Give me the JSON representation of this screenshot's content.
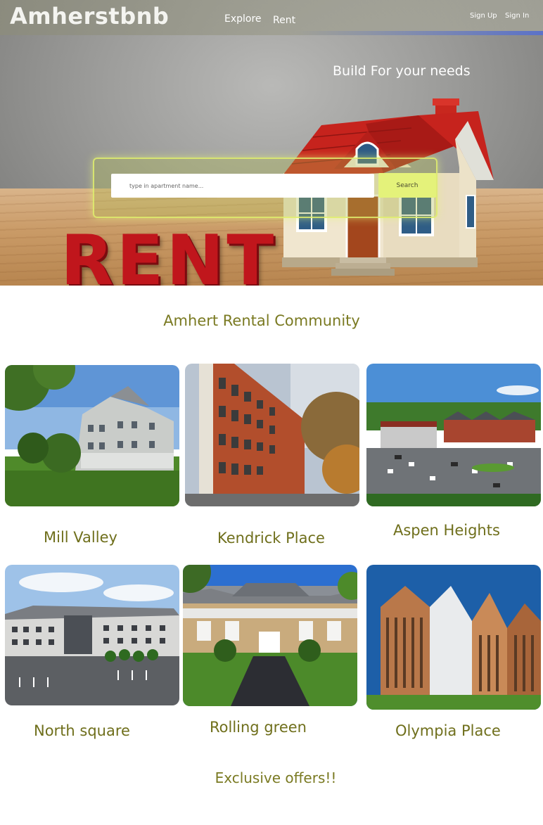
{
  "header": {
    "logo": "Amherstbnb",
    "nav": [
      {
        "label": "Explore"
      },
      {
        "label": "Rent"
      }
    ],
    "auth": {
      "signup": "Sign Up",
      "signin": "Sign In"
    }
  },
  "hero": {
    "tagline": "Build For your needs",
    "sign_text": "RENT",
    "search": {
      "placeholder": "type in apartment name...",
      "button_label": "Search"
    }
  },
  "community": {
    "title": "Amhert Rental Community",
    "listings": [
      {
        "name": "Mill Valley"
      },
      {
        "name": "Kendrick Place"
      },
      {
        "name": "Aspen Heights"
      },
      {
        "name": "North square"
      },
      {
        "name": "Rolling green"
      },
      {
        "name": "Olympia Place"
      }
    ]
  },
  "offers": {
    "title": "Exclusive offers!!"
  },
  "colors": {
    "accent_text": "#7a7a22",
    "search_button": "#e4f27a",
    "search_panel_border": "#e1f06e",
    "rent_red": "#c0161c"
  }
}
